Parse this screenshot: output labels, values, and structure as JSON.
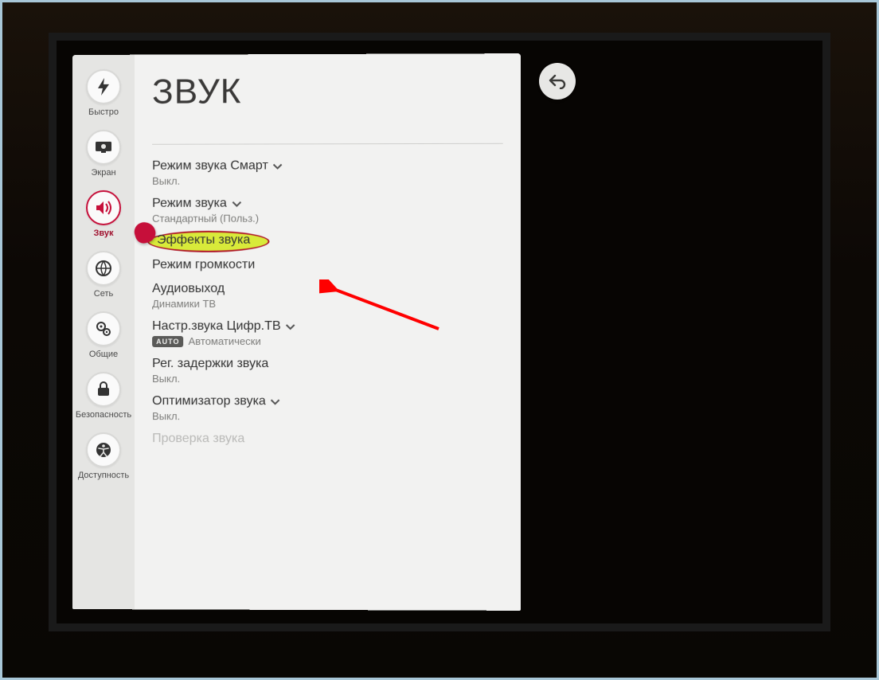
{
  "page": {
    "title": "ЗВУК"
  },
  "sidebar": {
    "items": [
      {
        "id": "quick",
        "label": "Быстро",
        "icon": "bolt"
      },
      {
        "id": "screen",
        "label": "Экран",
        "icon": "screen"
      },
      {
        "id": "sound",
        "label": "Звук",
        "icon": "sound",
        "active": true
      },
      {
        "id": "network",
        "label": "Сеть",
        "icon": "globe"
      },
      {
        "id": "general",
        "label": "Общие",
        "icon": "gears"
      },
      {
        "id": "security",
        "label": "Безопасность",
        "icon": "lock"
      },
      {
        "id": "access",
        "label": "Доступность",
        "icon": "access"
      }
    ]
  },
  "settings": {
    "smart_mode": {
      "label": "Режим звука Смарт",
      "value": "Выкл."
    },
    "sound_mode": {
      "label": "Режим звука",
      "value": "Стандартный (Польз.)"
    },
    "effects": {
      "label": "Эффекты звука"
    },
    "volume_mode": {
      "label": "Режим громкости"
    },
    "audio_out": {
      "label": "Аудиовыход",
      "value": "Динамики ТВ"
    },
    "dtv_setup": {
      "label": "Настр.звука Цифр.ТВ",
      "badge": "AUTO",
      "value": "Автоматически"
    },
    "delay": {
      "label": "Рег. задержки звука",
      "value": "Выкл."
    },
    "optimizer": {
      "label": "Оптимизатор звука",
      "value": "Выкл."
    },
    "check": {
      "label": "Проверка звука"
    }
  }
}
